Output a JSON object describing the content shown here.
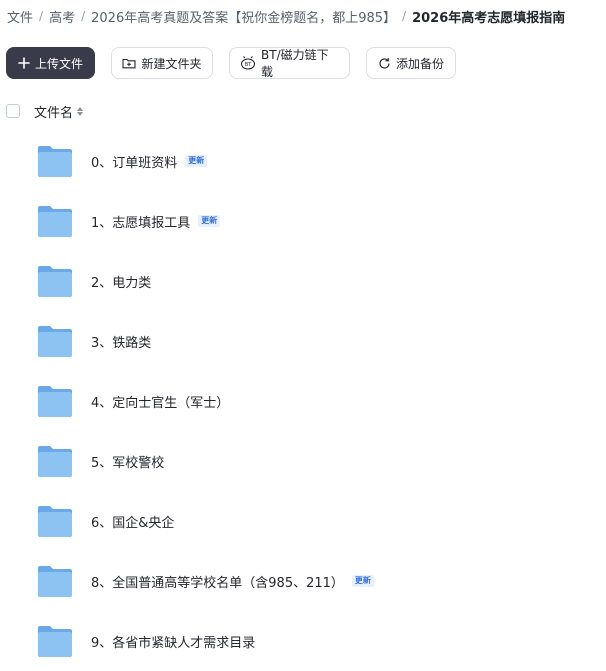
{
  "breadcrumb": [
    {
      "label": "文件"
    },
    {
      "label": "高考"
    },
    {
      "label": "2026年高考真题及答案【祝你金榜题名，都上985】"
    },
    {
      "label": "2026年高考志愿填报指南"
    }
  ],
  "toolbar": {
    "upload_label": "上传文件",
    "new_folder_label": "新建文件夹",
    "bt_label": "BT/磁力链下载",
    "backup_label": "添加备份"
  },
  "list_header": {
    "filename_label": "文件名"
  },
  "files": [
    {
      "name": "0、订单班资料",
      "badge": "更新"
    },
    {
      "name": "1、志愿填报工具",
      "badge": "更新"
    },
    {
      "name": "2、电力类",
      "badge": ""
    },
    {
      "name": "3、铁路类",
      "badge": ""
    },
    {
      "name": "4、定向士官生（军士）",
      "badge": ""
    },
    {
      "name": "5、军校警校",
      "badge": ""
    },
    {
      "name": "6、国企&央企",
      "badge": ""
    },
    {
      "name": "8、全国普通高等学校名单（含985、211）",
      "badge": "更新"
    },
    {
      "name": "9、各省市紧缺人才需求目录",
      "badge": ""
    }
  ],
  "colors": {
    "primary_button": "#3a3b4a",
    "folder": "#7fb6ef",
    "badge": "#2f6fe0"
  },
  "icons": {
    "upload": "plus-icon",
    "new_folder": "folder-plus-icon",
    "bt": "bt-icon",
    "backup": "refresh-icon",
    "folder": "folder-icon"
  }
}
